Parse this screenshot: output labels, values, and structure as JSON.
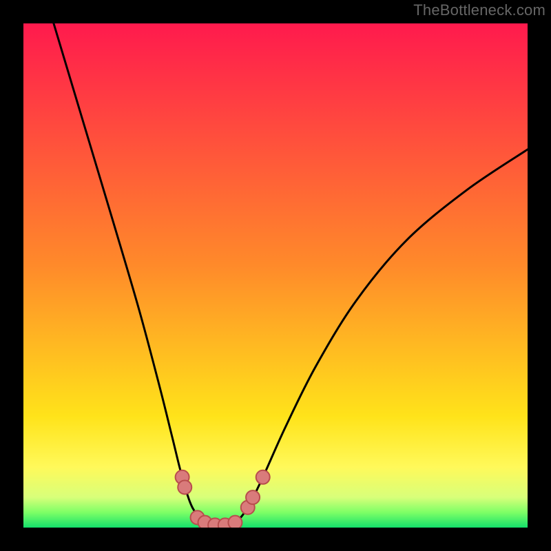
{
  "watermark": "TheBottleneck.com",
  "background_gradient": [
    {
      "offset": 0,
      "color": "#ff1a4d"
    },
    {
      "offset": 48,
      "color": "#ff8a2a"
    },
    {
      "offset": 78,
      "color": "#ffe31a"
    },
    {
      "offset": 88,
      "color": "#fff95a"
    },
    {
      "offset": 94,
      "color": "#d8ff7a"
    },
    {
      "offset": 97,
      "color": "#7dff66"
    },
    {
      "offset": 100,
      "color": "#14e06b"
    }
  ],
  "marker_style": {
    "fill": "#d97b7b",
    "stroke": "#b84d4d",
    "r": 10
  },
  "chart_data": {
    "type": "line",
    "title": "",
    "xlabel": "",
    "ylabel": "",
    "xlim": [
      0,
      100
    ],
    "ylim": [
      0,
      100
    ],
    "curve": [
      {
        "x": 6,
        "y": 100
      },
      {
        "x": 12,
        "y": 80
      },
      {
        "x": 18,
        "y": 60
      },
      {
        "x": 23,
        "y": 43
      },
      {
        "x": 27,
        "y": 28
      },
      {
        "x": 29.5,
        "y": 18
      },
      {
        "x": 31.5,
        "y": 10
      },
      {
        "x": 33.5,
        "y": 4
      },
      {
        "x": 36,
        "y": 1
      },
      {
        "x": 39,
        "y": 0
      },
      {
        "x": 42,
        "y": 1
      },
      {
        "x": 44.5,
        "y": 4
      },
      {
        "x": 47.5,
        "y": 10
      },
      {
        "x": 52,
        "y": 20
      },
      {
        "x": 58,
        "y": 32
      },
      {
        "x": 66,
        "y": 45
      },
      {
        "x": 76,
        "y": 57
      },
      {
        "x": 88,
        "y": 67
      },
      {
        "x": 100,
        "y": 75
      }
    ],
    "markers": [
      {
        "x": 31.5,
        "y": 10
      },
      {
        "x": 32.0,
        "y": 8
      },
      {
        "x": 34.5,
        "y": 2
      },
      {
        "x": 36.0,
        "y": 1
      },
      {
        "x": 38.0,
        "y": 0.5
      },
      {
        "x": 40.0,
        "y": 0.5
      },
      {
        "x": 42.0,
        "y": 1.0
      },
      {
        "x": 44.5,
        "y": 4
      },
      {
        "x": 45.5,
        "y": 6
      },
      {
        "x": 47.5,
        "y": 10
      }
    ]
  }
}
